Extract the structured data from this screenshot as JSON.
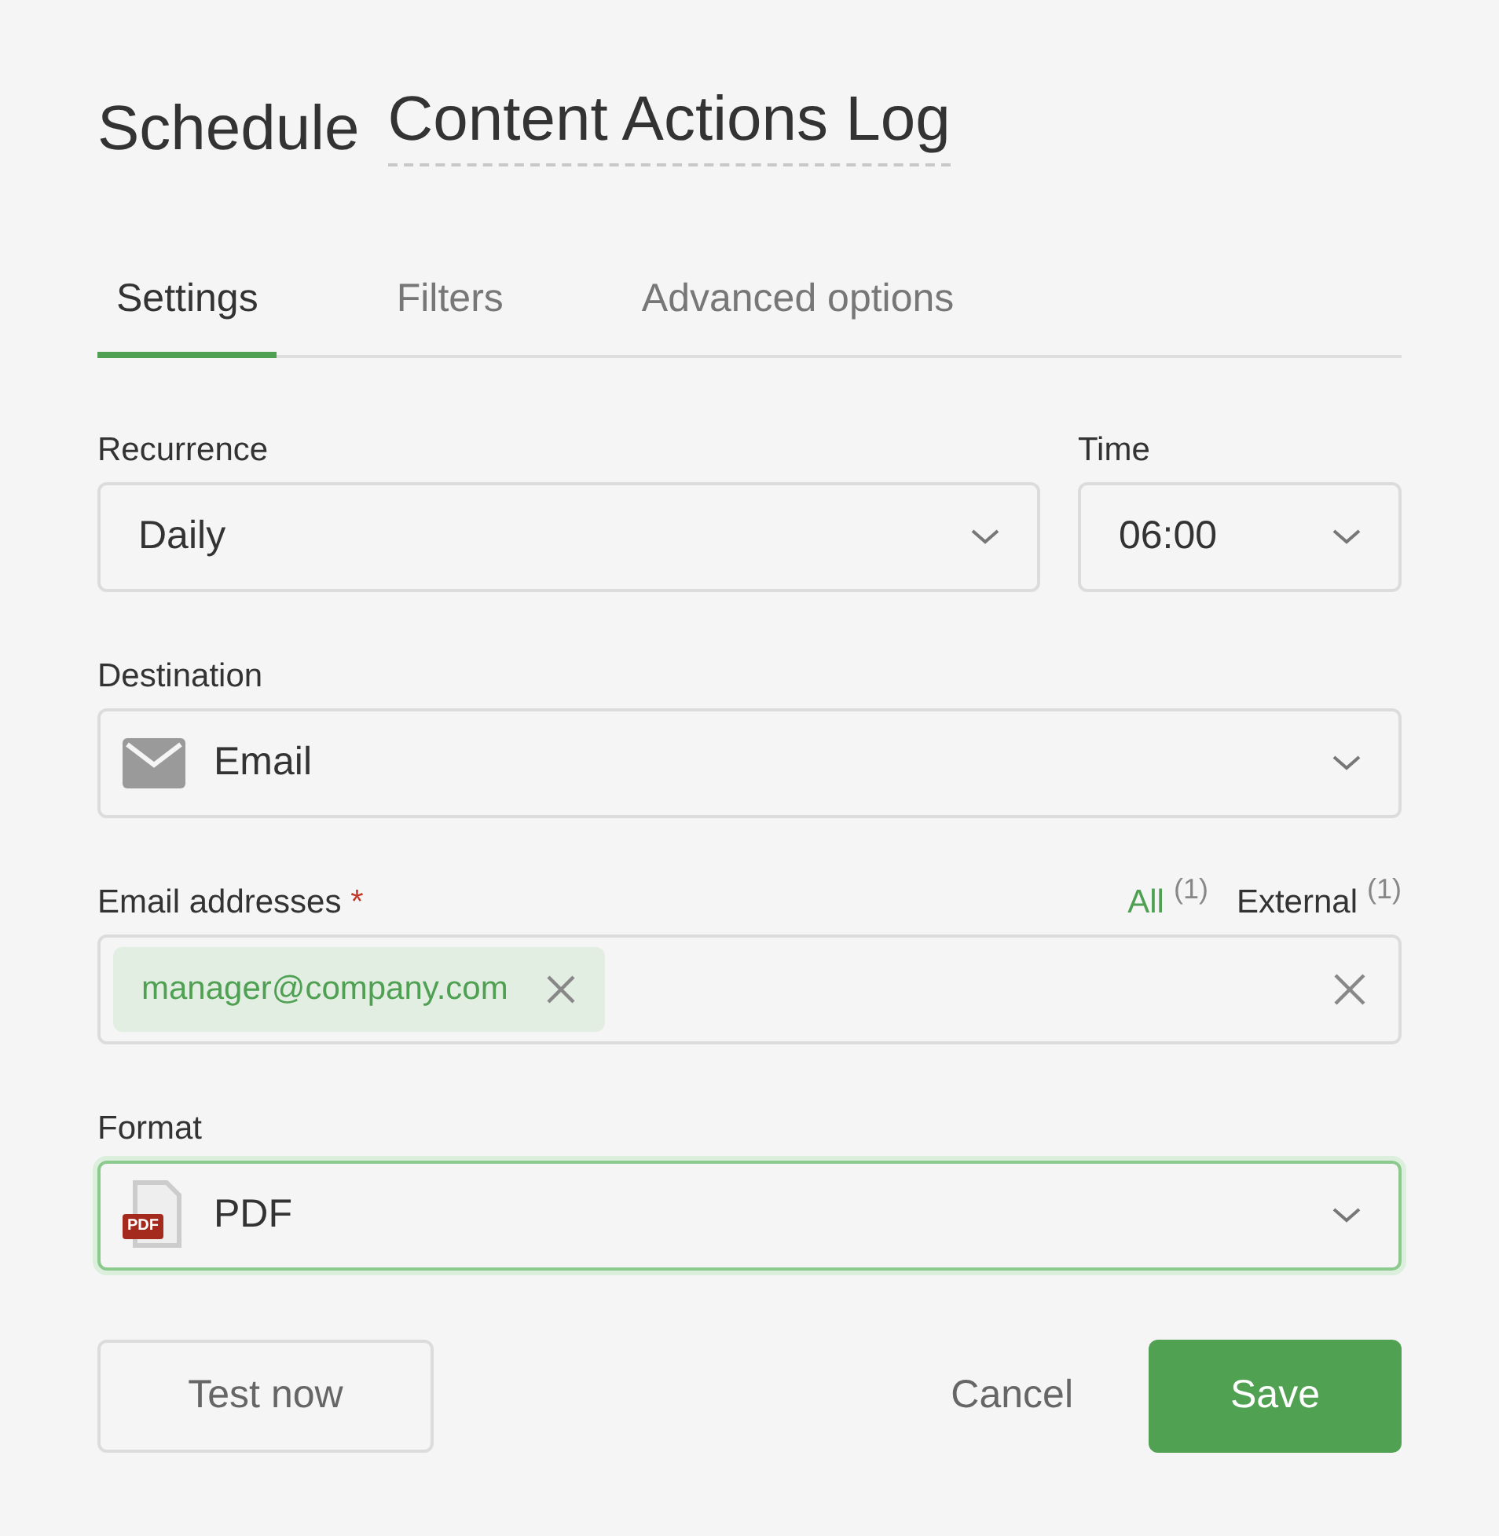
{
  "heading": {
    "prefix": "Schedule",
    "name": "Content Actions Log"
  },
  "tabs": [
    {
      "label": "Settings",
      "selected": true
    },
    {
      "label": "Filters",
      "selected": false
    },
    {
      "label": "Advanced options",
      "selected": false
    }
  ],
  "recurrence": {
    "label": "Recurrence",
    "value": "Daily",
    "focused": false
  },
  "time": {
    "label": "Time",
    "value": "06:00",
    "focused": false
  },
  "destination": {
    "label": "Destination",
    "value": "Email",
    "kind": "email",
    "focused": false
  },
  "email_addresses": {
    "label": "Email addresses",
    "required_mark": "*",
    "filters": [
      {
        "label": "All",
        "count": "(1)",
        "selected": true
      },
      {
        "label": "External",
        "count": "(1)",
        "selected": false
      }
    ],
    "chips": [
      {
        "text": "manager@company.com"
      }
    ]
  },
  "format": {
    "label": "Format",
    "value": "PDF",
    "kind": "pdf",
    "icon_label": "PDF",
    "focused": true
  },
  "buttons": {
    "test": "Test now",
    "cancel": "Cancel",
    "save": "Save"
  }
}
